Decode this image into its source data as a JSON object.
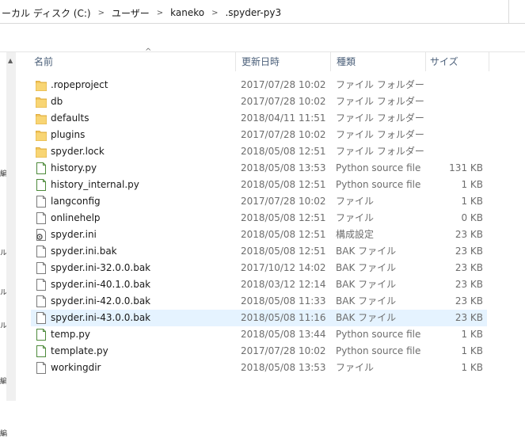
{
  "address": {
    "crumbs": [
      "ーカル ディスク (C:)",
      "ユーザー",
      "kaneko",
      ".spyder-py3"
    ]
  },
  "columns": {
    "name": "名前",
    "date": "更新日時",
    "type": "種類",
    "size": "サイズ"
  },
  "files": [
    {
      "icon": "folder-icon",
      "name": ".ropeproject",
      "date": "2017/07/28 10:02",
      "type": "ファイル フォルダー",
      "size": ""
    },
    {
      "icon": "folder-icon",
      "name": "db",
      "date": "2017/07/28 10:02",
      "type": "ファイル フォルダー",
      "size": ""
    },
    {
      "icon": "folder-icon",
      "name": "defaults",
      "date": "2018/04/11 11:51",
      "type": "ファイル フォルダー",
      "size": ""
    },
    {
      "icon": "folder-icon",
      "name": "plugins",
      "date": "2017/07/28 10:02",
      "type": "ファイル フォルダー",
      "size": ""
    },
    {
      "icon": "folder-icon",
      "name": "spyder.lock",
      "date": "2018/05/08 12:51",
      "type": "ファイル フォルダー",
      "size": ""
    },
    {
      "icon": "python-file-icon",
      "name": "history.py",
      "date": "2018/05/08 13:53",
      "type": "Python source file",
      "size": "131 KB"
    },
    {
      "icon": "python-file-icon",
      "name": "history_internal.py",
      "date": "2018/05/08 12:51",
      "type": "Python source file",
      "size": "1 KB"
    },
    {
      "icon": "file-icon",
      "name": "langconfig",
      "date": "2017/07/28 10:02",
      "type": "ファイル",
      "size": "1 KB"
    },
    {
      "icon": "file-icon",
      "name": "onlinehelp",
      "date": "2018/05/08 12:51",
      "type": "ファイル",
      "size": "0 KB"
    },
    {
      "icon": "config-file-icon",
      "name": "spyder.ini",
      "date": "2018/05/08 12:51",
      "type": "構成設定",
      "size": "23 KB"
    },
    {
      "icon": "file-icon",
      "name": "spyder.ini.bak",
      "date": "2018/05/08 12:51",
      "type": "BAK ファイル",
      "size": "23 KB"
    },
    {
      "icon": "file-icon",
      "name": "spyder.ini-32.0.0.bak",
      "date": "2017/10/12 14:02",
      "type": "BAK ファイル",
      "size": "23 KB"
    },
    {
      "icon": "file-icon",
      "name": "spyder.ini-40.1.0.bak",
      "date": "2018/03/12 12:14",
      "type": "BAK ファイル",
      "size": "23 KB"
    },
    {
      "icon": "file-icon",
      "name": "spyder.ini-42.0.0.bak",
      "date": "2018/05/08 11:33",
      "type": "BAK ファイル",
      "size": "23 KB"
    },
    {
      "icon": "file-icon",
      "name": "spyder.ini-43.0.0.bak",
      "date": "2018/05/08 11:16",
      "type": "BAK ファイル",
      "size": "23 KB",
      "selected": true
    },
    {
      "icon": "python-file-icon",
      "name": "temp.py",
      "date": "2018/05/08 13:44",
      "type": "Python source file",
      "size": "1 KB"
    },
    {
      "icon": "python-file-icon",
      "name": "template.py",
      "date": "2017/07/28 10:02",
      "type": "Python source file",
      "size": "1 KB"
    },
    {
      "icon": "file-icon",
      "name": "workingdir",
      "date": "2018/05/08 13:53",
      "type": "ファイル",
      "size": "1 KB"
    }
  ],
  "nav": {
    "glyphs": [
      "編",
      "ル",
      "ル",
      "ル",
      "編",
      "編"
    ]
  },
  "colors": {
    "folder": "#f2c55c",
    "python": "#4d8a3a",
    "selection": "#e5f3ff",
    "header_text": "#4c607a"
  }
}
